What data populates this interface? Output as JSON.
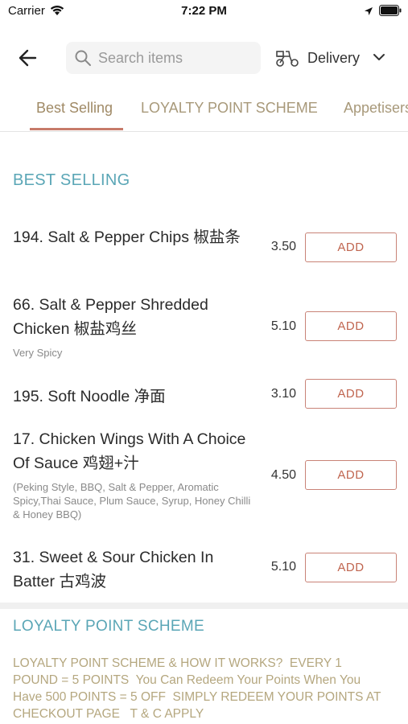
{
  "status_bar": {
    "carrier": "Carrier",
    "time": "7:22 PM"
  },
  "header": {
    "back_icon": "arrow-left-icon",
    "search_placeholder": "Search items",
    "delivery_label": "Delivery"
  },
  "tabs": [
    {
      "label": "Best Selling",
      "active": true
    },
    {
      "label": "LOYALTY POINT SCHEME",
      "active": false
    },
    {
      "label": "Appetisers",
      "active": false
    }
  ],
  "sections": {
    "best_selling_title": "BEST SELLING",
    "loyalty_title": "LOYALTY POINT SCHEME",
    "loyalty_text": "LOYALTY POINT SCHEME & HOW IT WORKS?  EVERY 1\nPOUND = 5 POINTS  You Can Redeem Your Points When You\nHave 500 POINTS = 5 OFF  SIMPLY REDEEM YOUR POINTS AT\nCHECKOUT PAGE   T & C APPLY"
  },
  "items": [
    {
      "name": "194. Salt & Pepper Chips 椒盐条",
      "desc": "",
      "price": "3.50",
      "add_label": "ADD"
    },
    {
      "name": "66. Salt & Pepper Shredded Chicken 椒盐鸡丝",
      "desc": "Very Spicy",
      "price": "5.10",
      "add_label": "ADD"
    },
    {
      "name": "195. Soft Noodle 净面",
      "desc": "",
      "price": "3.10",
      "add_label": "ADD"
    },
    {
      "name": "17. Chicken Wings With A Choice Of Sauce 鸡翅+汁",
      "desc": "(Peking Style, BBQ, Salt & Pepper, Aromatic Spicy,Thai Sauce, Plum Sauce, Syrup, Honey Chilli & Honey BBQ)",
      "price": "4.50",
      "add_label": "ADD"
    },
    {
      "name": "31. Sweet & Sour Chicken In Batter 古鸡波",
      "desc": "",
      "price": "5.10",
      "add_label": "ADD"
    }
  ],
  "colors": {
    "accent_teal": "#5aa6b6",
    "add_red": "#c0654f",
    "tab_gold": "#a8997a",
    "loyalty_gold": "#b5a77f"
  }
}
